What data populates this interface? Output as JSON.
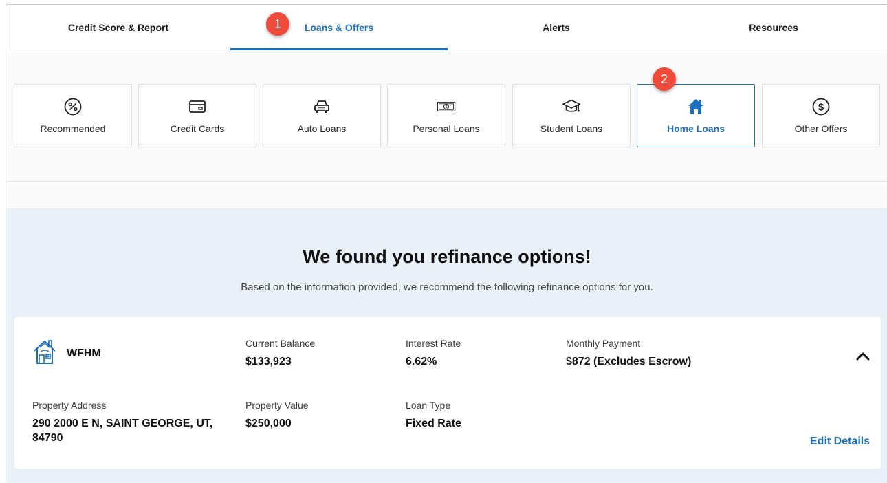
{
  "tabs": [
    {
      "label": "Credit Score & Report",
      "active": false
    },
    {
      "label": "Loans & Offers",
      "active": true
    },
    {
      "label": "Alerts",
      "active": false
    },
    {
      "label": "Resources",
      "active": false
    }
  ],
  "badges": {
    "step1": "1",
    "step2": "2"
  },
  "categories": [
    {
      "label": "Recommended",
      "icon": "percent-circle-icon"
    },
    {
      "label": "Credit Cards",
      "icon": "credit-card-icon"
    },
    {
      "label": "Auto Loans",
      "icon": "car-icon"
    },
    {
      "label": "Personal Loans",
      "icon": "cash-bill-icon"
    },
    {
      "label": "Student Loans",
      "icon": "graduation-cap-icon"
    },
    {
      "label": "Home Loans",
      "icon": "house-icon",
      "selected": true
    },
    {
      "label": "Other Offers",
      "icon": "dollar-circle-icon"
    }
  ],
  "main": {
    "headline": "We found you refinance options!",
    "subline": "Based on the information provided, we recommend the following refinance options for you."
  },
  "loan": {
    "lender": "WFHM",
    "current_balance_label": "Current Balance",
    "current_balance": "$133,923",
    "interest_rate_label": "Interest Rate",
    "interest_rate": "6.62%",
    "monthly_payment_label": "Monthly Payment",
    "monthly_payment": "$872 (Excludes Escrow)",
    "property_address_label": "Property Address",
    "property_address_line1": "290 2000 E N, SAINT GEORGE, UT,",
    "property_address_line2": "84790",
    "property_value_label": "Property Value",
    "property_value": "$250,000",
    "loan_type_label": "Loan Type",
    "loan_type": "Fixed Rate",
    "edit_label": "Edit Details"
  },
  "colors": {
    "accent": "#1c6fbd",
    "badge": "#ef4b3b",
    "section_bg": "#e9f0f8"
  }
}
